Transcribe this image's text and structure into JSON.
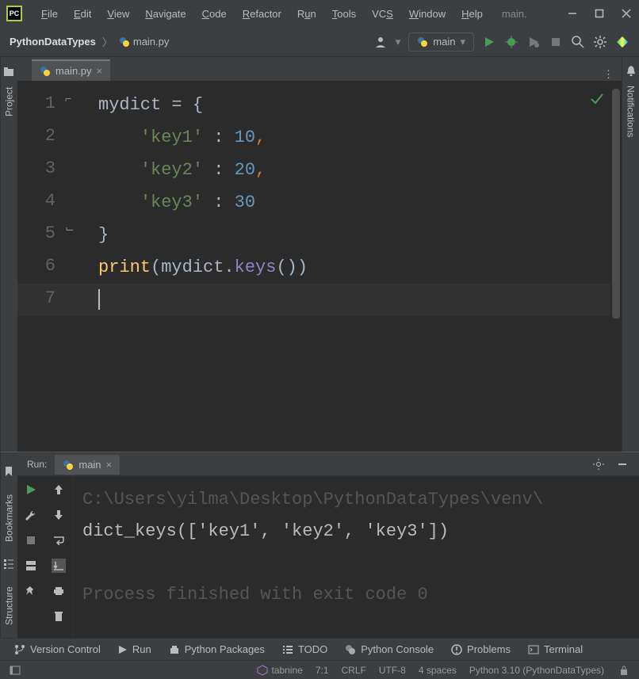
{
  "window": {
    "app_title": "main."
  },
  "menus": [
    "File",
    "Edit",
    "View",
    "Navigate",
    "Code",
    "Refactor",
    "Run",
    "Tools",
    "VCS",
    "Window",
    "Help"
  ],
  "breadcrumb": {
    "project": "PythonDataTypes",
    "file": "main.py"
  },
  "run_config": {
    "label": "main"
  },
  "editor_tab": {
    "label": "main.py"
  },
  "left_sidebar": {
    "project": "Project"
  },
  "right_sidebar": {
    "notifications": "Notifications"
  },
  "code": {
    "lines": [
      "1",
      "2",
      "3",
      "4",
      "5",
      "6",
      "7"
    ],
    "l1_id": "mydict",
    "l1_brace": "{",
    "l2_key": "'key1'",
    "l2_val": "10",
    "l3_key": "'key2'",
    "l3_val": "20",
    "l4_key": "'key3'",
    "l4_val": "30",
    "l5_brace": "}",
    "l6_print": "print",
    "l6_arg": "mydict",
    "l6_method": "keys"
  },
  "run_panel": {
    "title": "Run:",
    "tab": "main",
    "path_line": "C:\\Users\\yilma\\Desktop\\PythonDataTypes\\venv\\",
    "output": "dict_keys(['key1', 'key2', 'key3'])",
    "exit": "Process finished with exit code 0"
  },
  "run_left": {
    "bookmarks": "Bookmarks",
    "structure": "Structure"
  },
  "bottom_bar": {
    "vcs": "Version Control",
    "run": "Run",
    "packages": "Python Packages",
    "todo": "TODO",
    "console": "Python Console",
    "problems": "Problems",
    "terminal": "Terminal"
  },
  "status": {
    "tabnine": "tabnine",
    "pos": "7:1",
    "eol": "CRLF",
    "enc": "UTF-8",
    "indent": "4 spaces",
    "interpreter": "Python 3.10 (PythonDataTypes)"
  }
}
